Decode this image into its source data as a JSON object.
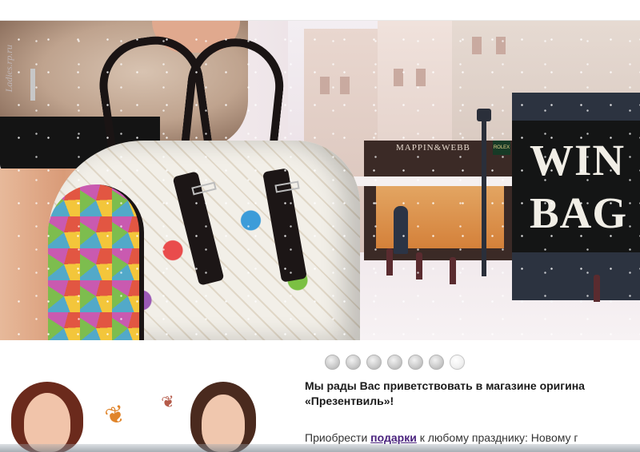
{
  "banner": {
    "promo_line1": "WIN",
    "promo_line2": "BAG",
    "watermark": "Ladies.rp.ru",
    "shop_sign": "MAPPIN&WEBB",
    "rolex_sign": "ROLEX"
  },
  "slider": {
    "dots": [
      "1",
      "2",
      "3",
      "4",
      "5",
      "6",
      "7"
    ],
    "active_index": 6
  },
  "content": {
    "welcome_line1": "Мы рады Вас приветствовать в магазине оригина",
    "welcome_line2": "«Презентвиль»!",
    "intro_before": "Приобрести ",
    "intro_link": "подарки",
    "intro_after": " к любому празднику: Новому г"
  }
}
